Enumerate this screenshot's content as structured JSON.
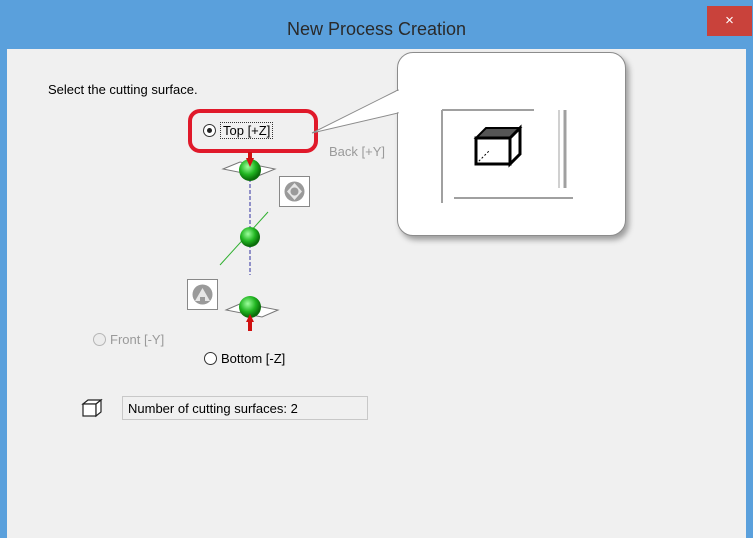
{
  "window": {
    "title": "New Process Creation",
    "close_label": "×"
  },
  "instruction": "Select the cutting surface.",
  "surfaces": {
    "top": {
      "label": "Top [+Z]",
      "selected": true,
      "enabled": true
    },
    "back": {
      "label": "Back [+Y]",
      "selected": false,
      "enabled": false
    },
    "front": {
      "label": "Front [-Y]",
      "selected": false,
      "enabled": false
    },
    "bottom": {
      "label": "Bottom [-Z]",
      "selected": false,
      "enabled": true
    }
  },
  "count_label": "Number of cutting surfaces: 2",
  "colors": {
    "titlebar": "#5aa0dc",
    "highlight": "#e0192a",
    "sphere": "#21b521",
    "arrow": "#d01010"
  }
}
